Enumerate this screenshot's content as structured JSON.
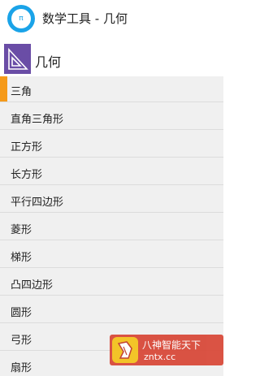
{
  "header": {
    "app_icon": "math-tool-icon",
    "logo_text": "π",
    "title": "数学工具 - 几何"
  },
  "section": {
    "icon": "set-square-icon",
    "title": "几何"
  },
  "list": {
    "active_index": 0,
    "active_color": "#f59a1a",
    "items": [
      {
        "label": "三角"
      },
      {
        "label": "直角三角形"
      },
      {
        "label": "正方形"
      },
      {
        "label": "长方形"
      },
      {
        "label": "平行四边形"
      },
      {
        "label": "菱形"
      },
      {
        "label": "梯形"
      },
      {
        "label": "凸四边形"
      },
      {
        "label": "圆形"
      },
      {
        "label": "弓形"
      },
      {
        "label": "扇形"
      }
    ]
  },
  "watermark": {
    "logo": "zntx-logo-icon",
    "line1": "八神智能天下",
    "line2": "zntx.cc"
  }
}
